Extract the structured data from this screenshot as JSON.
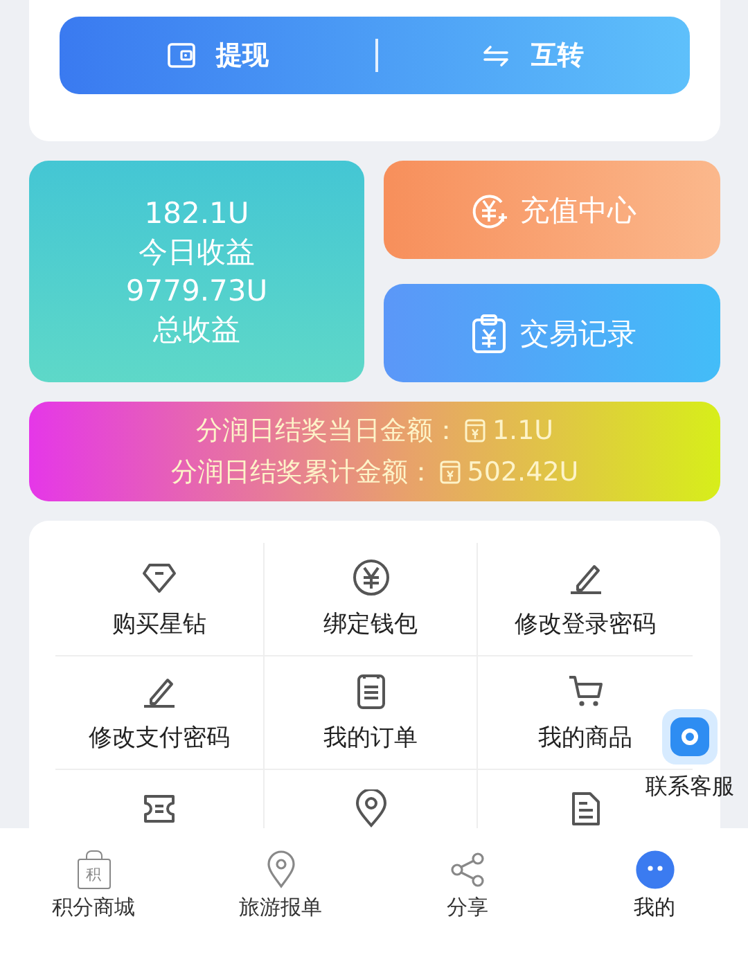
{
  "action_bar": [
    {
      "label": "提现"
    },
    {
      "label": "互转"
    }
  ],
  "earnings": {
    "today_value": "182.1U",
    "today_label": "今日收益",
    "total_value": "9779.73U",
    "total_label": "总收益"
  },
  "side_buttons": [
    {
      "label": "充值中心"
    },
    {
      "label": "交易记录"
    }
  ],
  "dividend_banner": [
    {
      "label": "分润日结奖当日金额：",
      "amount": "1.1U"
    },
    {
      "label": "分润日结奖累计金额：",
      "amount": "502.42U"
    }
  ],
  "menu": [
    {
      "label": "购买星钻"
    },
    {
      "label": "绑定钱包"
    },
    {
      "label": "修改登录密码"
    },
    {
      "label": "修改支付密码"
    },
    {
      "label": "我的订单"
    },
    {
      "label": "我的商品"
    }
  ],
  "float_service": {
    "label": "联系客服"
  },
  "bottom_nav": [
    {
      "label": "积分商城",
      "icon_text": "积",
      "selected": false
    },
    {
      "label": "旅游报单",
      "selected": false
    },
    {
      "label": "分享",
      "selected": false
    },
    {
      "label": "我的",
      "selected": true
    }
  ]
}
